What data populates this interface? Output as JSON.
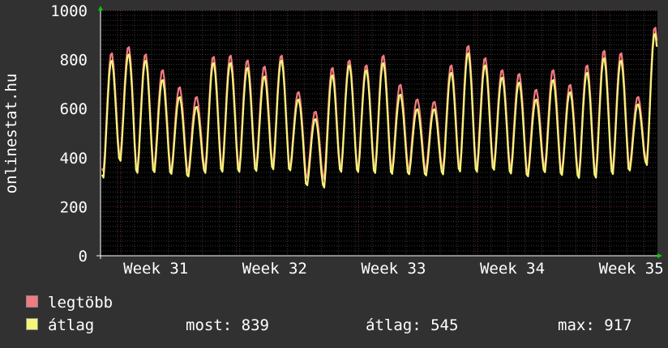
{
  "chart_data": {
    "type": "line",
    "ylabel": "onlinestat.hu",
    "ylim": [
      0,
      1000
    ],
    "yticks": [
      0,
      200,
      400,
      600,
      800,
      1000
    ],
    "xticks": [
      "Week 31",
      "Week 32",
      "Week 33",
      "Week 34",
      "Week 35"
    ],
    "grid": true,
    "legend_position": "bottom-left",
    "series": [
      {
        "name": "legtöbb",
        "color": "#f27a80",
        "daily": [
          {
            "peak": 830,
            "trough": 330
          },
          {
            "peak": 855,
            "trough": 395
          },
          {
            "peak": 825,
            "trough": 340
          },
          {
            "peak": 760,
            "trough": 350
          },
          {
            "peak": 690,
            "trough": 340
          },
          {
            "peak": 650,
            "trough": 335
          },
          {
            "peak": 815,
            "trough": 345
          },
          {
            "peak": 820,
            "trough": 350
          },
          {
            "peak": 800,
            "trough": 350
          },
          {
            "peak": 775,
            "trough": 355
          },
          {
            "peak": 820,
            "trough": 360
          },
          {
            "peak": 670,
            "trough": 355
          },
          {
            "peak": 590,
            "trough": 310
          },
          {
            "peak": 770,
            "trough": 300
          },
          {
            "peak": 800,
            "trough": 345
          },
          {
            "peak": 780,
            "trough": 345
          },
          {
            "peak": 820,
            "trough": 345
          },
          {
            "peak": 700,
            "trough": 345
          },
          {
            "peak": 640,
            "trough": 345
          },
          {
            "peak": 630,
            "trough": 340
          },
          {
            "peak": 780,
            "trough": 340
          },
          {
            "peak": 860,
            "trough": 350
          },
          {
            "peak": 810,
            "trough": 350
          },
          {
            "peak": 760,
            "trough": 360
          },
          {
            "peak": 745,
            "trough": 345
          },
          {
            "peak": 680,
            "trough": 330
          },
          {
            "peak": 760,
            "trough": 350
          },
          {
            "peak": 700,
            "trough": 335
          },
          {
            "peak": 780,
            "trough": 320
          },
          {
            "peak": 840,
            "trough": 325
          },
          {
            "peak": 830,
            "trough": 340
          },
          {
            "peak": 650,
            "trough": 360
          },
          {
            "peak": 935,
            "trough": 370
          }
        ]
      },
      {
        "name": "átlag",
        "color": "#f5f57a",
        "daily": [
          {
            "peak": 800,
            "trough": 305
          },
          {
            "peak": 825,
            "trough": 375
          },
          {
            "peak": 800,
            "trough": 325
          },
          {
            "peak": 720,
            "trough": 330
          },
          {
            "peak": 650,
            "trough": 325
          },
          {
            "peak": 610,
            "trough": 315
          },
          {
            "peak": 790,
            "trough": 325
          },
          {
            "peak": 790,
            "trough": 330
          },
          {
            "peak": 770,
            "trough": 330
          },
          {
            "peak": 735,
            "trough": 335
          },
          {
            "peak": 800,
            "trough": 340
          },
          {
            "peak": 640,
            "trough": 340
          },
          {
            "peak": 560,
            "trough": 280
          },
          {
            "peak": 740,
            "trough": 265
          },
          {
            "peak": 780,
            "trough": 330
          },
          {
            "peak": 760,
            "trough": 330
          },
          {
            "peak": 790,
            "trough": 325
          },
          {
            "peak": 660,
            "trough": 325
          },
          {
            "peak": 600,
            "trough": 325
          },
          {
            "peak": 600,
            "trough": 320
          },
          {
            "peak": 750,
            "trough": 320
          },
          {
            "peak": 830,
            "trough": 330
          },
          {
            "peak": 780,
            "trough": 330
          },
          {
            "peak": 730,
            "trough": 340
          },
          {
            "peak": 710,
            "trough": 325
          },
          {
            "peak": 640,
            "trough": 315
          },
          {
            "peak": 720,
            "trough": 330
          },
          {
            "peak": 670,
            "trough": 320
          },
          {
            "peak": 750,
            "trough": 305
          },
          {
            "peak": 810,
            "trough": 305
          },
          {
            "peak": 800,
            "trough": 320
          },
          {
            "peak": 620,
            "trough": 340
          },
          {
            "peak": 910,
            "trough": 355
          }
        ]
      }
    ]
  },
  "legend": {
    "items": [
      {
        "label": "legtöbb",
        "color": "#f27a80"
      },
      {
        "label": "átlag",
        "color": "#f5f57a"
      }
    ]
  },
  "stats": {
    "most": "most: 839",
    "atlag": "átlag: 545",
    "max": "max: 917"
  }
}
